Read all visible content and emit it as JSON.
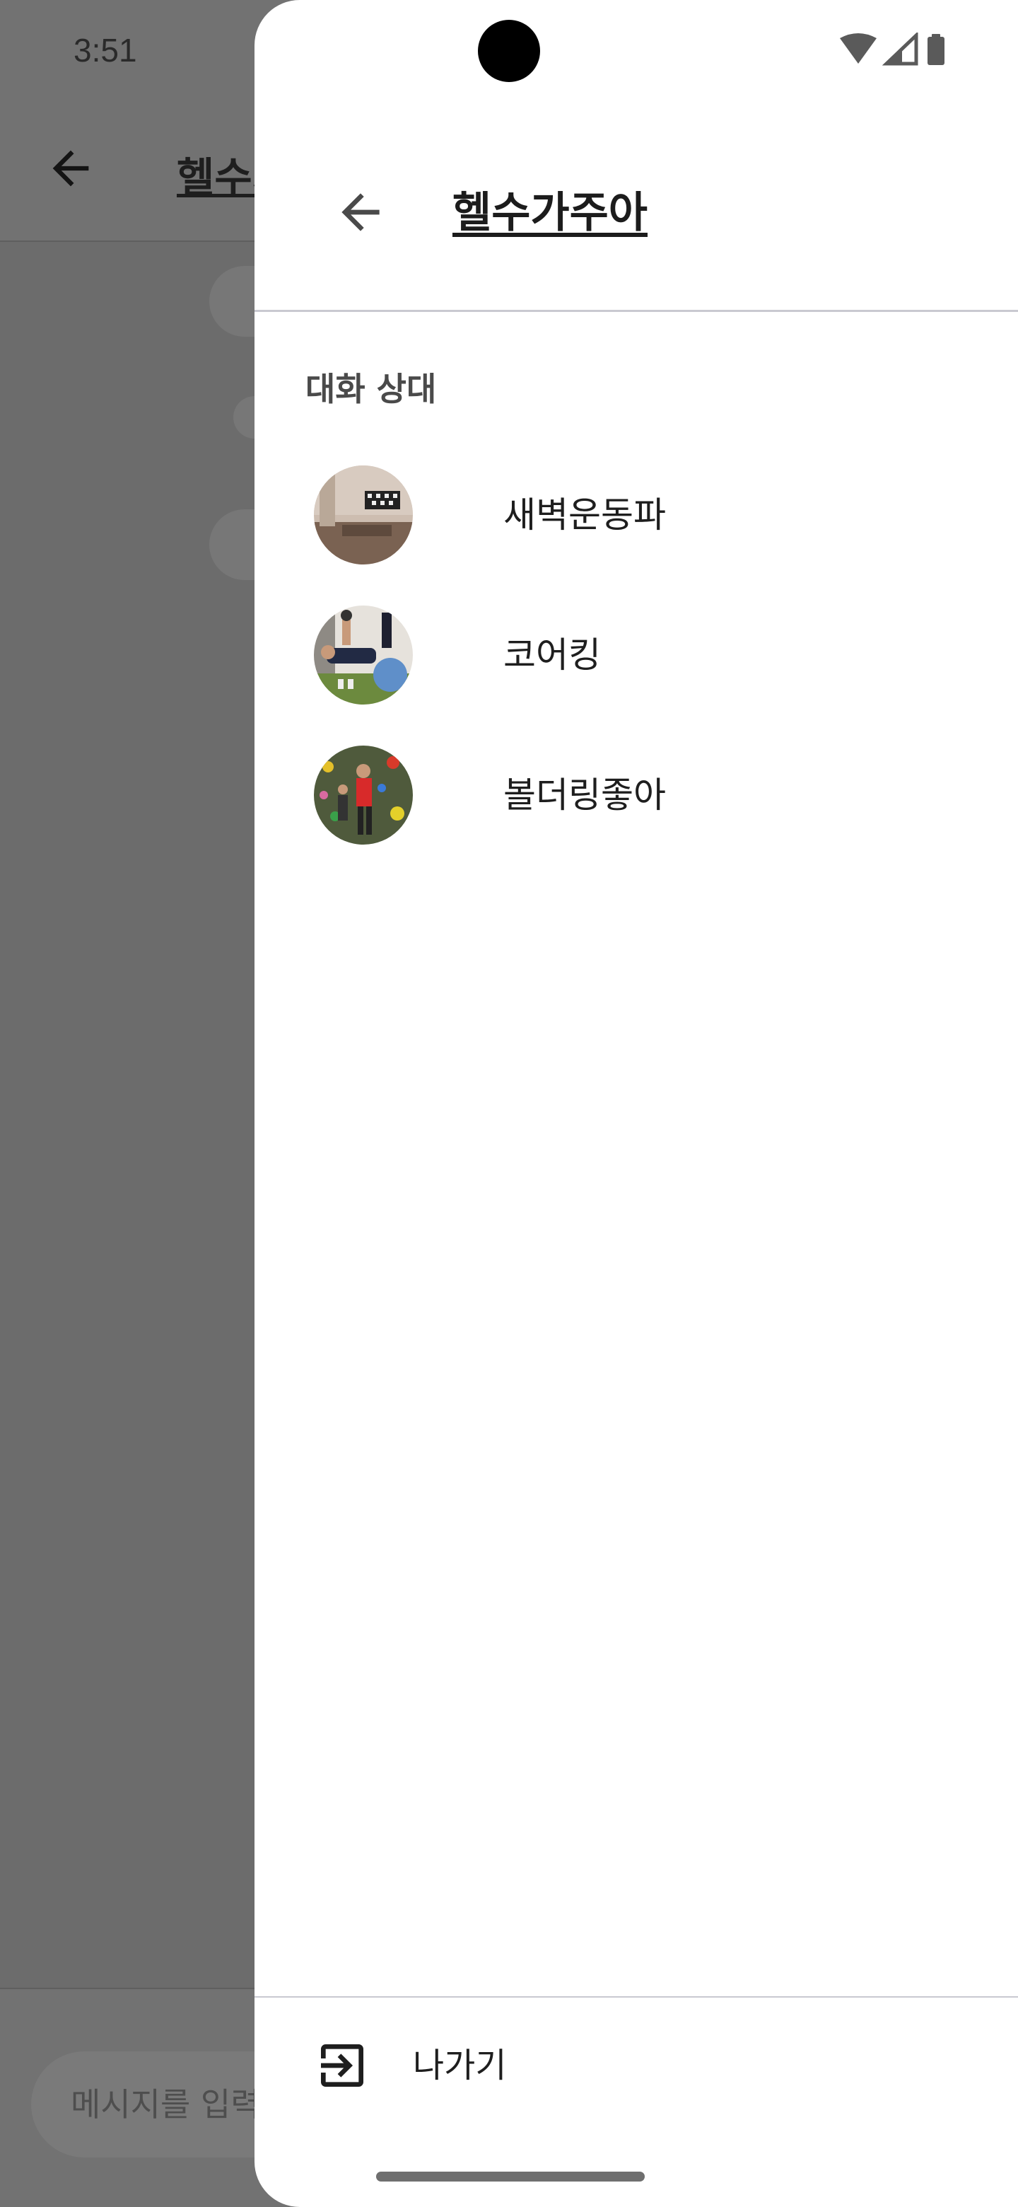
{
  "status_bar": {
    "time": "3:51",
    "icons": [
      "wifi-icon",
      "cell-signal-icon",
      "battery-icon"
    ]
  },
  "background_chat": {
    "title": "헬수가주아",
    "input_placeholder": "메시지를 입력"
  },
  "drawer": {
    "title": "헬수가주아",
    "section_label": "대화 상대",
    "members": [
      {
        "name": "새벽운동파",
        "avatar": "avatar-home-gym-icon"
      },
      {
        "name": "코어킹",
        "avatar": "avatar-exercise-ball-icon"
      },
      {
        "name": "볼더링좋아",
        "avatar": "avatar-climbing-wall-icon"
      }
    ],
    "leave_label": "나가기"
  },
  "colors": {
    "scrim": "#6c6c6c",
    "drawer_bg": "#ffffff",
    "divider": "#c9c9d1",
    "text_primary": "#1e1e1e",
    "text_section": "#4a4a4a"
  }
}
